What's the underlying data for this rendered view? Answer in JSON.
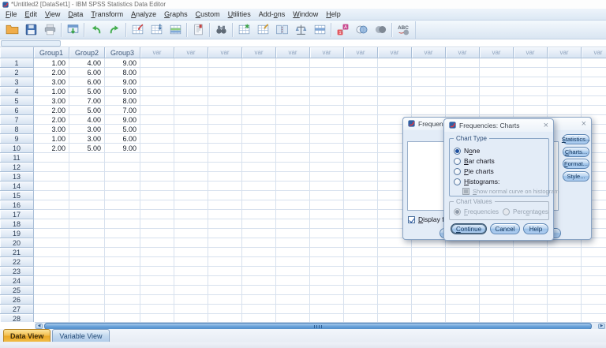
{
  "window": {
    "title": "*Untitled2 [DataSet1] - IBM SPSS Statistics Data Editor"
  },
  "menu": {
    "items": [
      {
        "label": "File",
        "m": 0
      },
      {
        "label": "Edit",
        "m": 0
      },
      {
        "label": "View",
        "m": 0
      },
      {
        "label": "Data",
        "m": 0
      },
      {
        "label": "Transform",
        "m": 0
      },
      {
        "label": "Analyze",
        "m": 0
      },
      {
        "label": "Graphs",
        "m": 0
      },
      {
        "label": "Custom",
        "m": 0
      },
      {
        "label": "Utilities",
        "m": 0
      },
      {
        "label": "Add-ons",
        "m": 4
      },
      {
        "label": "Window",
        "m": 0
      },
      {
        "label": "Help",
        "m": 0
      }
    ]
  },
  "toolbar": {
    "groups": [
      [
        "open-data",
        "save",
        "print"
      ],
      [
        "recall-dialogs"
      ],
      [
        "undo",
        "redo"
      ],
      [
        "goto-case",
        "goto-variable",
        "variables"
      ],
      [
        "file-info"
      ],
      [
        "find"
      ],
      [
        "insert-cases",
        "insert-variable",
        "split-file",
        "weight-cases",
        "select-cases"
      ],
      [
        "value-labels",
        "use-variable-sets",
        "show-all-variables"
      ],
      [
        "spell-check"
      ]
    ]
  },
  "grid": {
    "named_columns": [
      "Group1",
      "Group2",
      "Group3"
    ],
    "var_label": "var",
    "var_count": 14,
    "rows": [
      [
        "1.00",
        "4.00",
        "9.00"
      ],
      [
        "2.00",
        "6.00",
        "8.00"
      ],
      [
        "3.00",
        "6.00",
        "9.00"
      ],
      [
        "1.00",
        "5.00",
        "9.00"
      ],
      [
        "3.00",
        "7.00",
        "8.00"
      ],
      [
        "2.00",
        "5.00",
        "7.00"
      ],
      [
        "2.00",
        "4.00",
        "9.00"
      ],
      [
        "3.00",
        "3.00",
        "5.00"
      ],
      [
        "1.00",
        "3.00",
        "6.00"
      ],
      [
        "2.00",
        "5.00",
        "9.00"
      ]
    ],
    "visible_row_count": 28
  },
  "tabs": [
    {
      "label": "Data View",
      "active": true
    },
    {
      "label": "Variable View",
      "active": false
    }
  ],
  "dialogs": {
    "frequencies": {
      "title": "Frequencies",
      "display_checkbox": {
        "label": "Display freq",
        "m": 0,
        "checked": true
      },
      "side_buttons": [
        {
          "label": "Statistics...",
          "m": 0
        },
        {
          "label": "Charts...",
          "m": 0
        },
        {
          "label": "Format...",
          "m": 0
        },
        {
          "label": "Style...",
          "m": -1
        }
      ],
      "close_glyph": "×"
    },
    "frequencies_charts": {
      "title": "Frequencies: Charts",
      "close_glyph": "×",
      "chart_type": {
        "legend": "Chart Type",
        "options": [
          {
            "label": "None",
            "m": 1,
            "selected": true,
            "disabled": false
          },
          {
            "label": "Bar charts",
            "m": 0,
            "selected": false,
            "disabled": false
          },
          {
            "label": "Pie charts",
            "m": 0,
            "selected": false,
            "disabled": false
          },
          {
            "label": "Histograms:",
            "m": 0,
            "selected": false,
            "disabled": false
          }
        ],
        "sub_checkbox": {
          "label": "Show normal curve on histogram",
          "m": 0,
          "checked": false,
          "disabled": true
        }
      },
      "chart_values": {
        "legend": "Chart Values",
        "disabled": true,
        "options": [
          {
            "label": "Frequencies",
            "m": 0,
            "selected": true
          },
          {
            "label": "Percentages",
            "m": 4,
            "selected": false
          }
        ]
      },
      "buttons": [
        {
          "label": "Continue",
          "m": 0,
          "default": true
        },
        {
          "label": "Cancel",
          "m": -1,
          "default": false
        },
        {
          "label": "Help",
          "m": -1,
          "default": false
        }
      ]
    }
  },
  "colors": {
    "accent_blue": "#3a6ea5",
    "active_tab_gold": "#f0b844",
    "dialog_bg": "#e3ecf7",
    "grid_line": "#d7e1ee"
  }
}
